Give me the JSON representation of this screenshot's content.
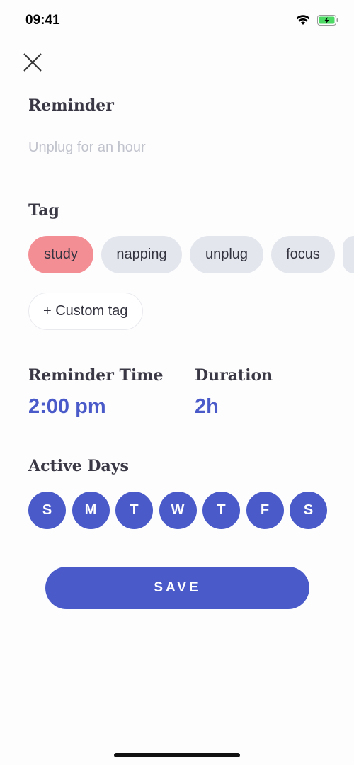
{
  "status_bar": {
    "time": "09:41",
    "icons": [
      "wifi-icon",
      "battery-charging-icon"
    ]
  },
  "close_icon": "close-icon",
  "reminder": {
    "label": "Reminder",
    "placeholder": "Unplug for an hour",
    "value": ""
  },
  "tag": {
    "label": "Tag",
    "items": [
      "study",
      "napping",
      "unplug",
      "focus",
      ""
    ],
    "selected": "study",
    "custom_label": "+ Custom tag"
  },
  "reminder_time": {
    "label": "Reminder Time",
    "value": "2:00 pm"
  },
  "duration": {
    "label": "Duration",
    "value": "2h"
  },
  "active_days": {
    "label": "Active Days",
    "days": [
      "S",
      "M",
      "T",
      "W",
      "T",
      "F",
      "S"
    ]
  },
  "save_label": "SAVE",
  "colors": {
    "accent": "#4a5bc9",
    "selected_tag": "#f48e95",
    "tag_bg": "#e3e6ed"
  }
}
